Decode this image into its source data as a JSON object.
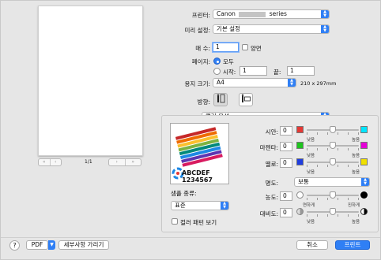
{
  "window": {
    "printer_label": "프린터:",
    "printer_value_prefix": "Canon",
    "printer_value_suffix": "series",
    "preset_label": "미리 설정:",
    "preset_value": "기본 설정",
    "copies_label": "매 수:",
    "copies_value": "1",
    "duplex_label": "양면",
    "pages_label": "페이지:",
    "pages_all": "모두",
    "pages_from": "시작:",
    "pages_from_value": "1",
    "pages_to": "끝:",
    "pages_to_value": "1",
    "paper_label": "용지 크기:",
    "paper_value": "A4",
    "paper_dims": "210 x 297mm",
    "orientation_label": "방향:",
    "section_value": "컬러 옵션"
  },
  "preview": {
    "page_indicator": "1/1",
    "first": "«",
    "prev": "‹",
    "next": "›",
    "last": "»"
  },
  "sample": {
    "text_line1": "ABCDEF",
    "text_line2": "1234567",
    "type_label": "샘플 종류:",
    "type_value": "표준",
    "pattern_label": "컬러 패턴 보기"
  },
  "color_adjust": {
    "cyan": {
      "label": "시안:",
      "value": "0",
      "low": "낮음",
      "high": "높음",
      "color": "#00c0e0",
      "swatch_left": "#e53935",
      "swatch_right": "#00e5ff"
    },
    "magenta": {
      "label": "마젠타:",
      "value": "0",
      "low": "낮음",
      "high": "높음",
      "color": "#e0007a",
      "swatch_left": "#1ec41e",
      "swatch_right": "#e600d8"
    },
    "yellow": {
      "label": "옐로:",
      "value": "0",
      "low": "낮음",
      "high": "높음",
      "color": "#f5e000",
      "swatch_left": "#1f3de0",
      "swatch_right": "#f0e000"
    },
    "tone_label": "명도:",
    "tone_value": "보통",
    "intensity": {
      "label": "농도:",
      "value": "0",
      "low": "연하게",
      "high": "진하게"
    },
    "contrast": {
      "label": "대비도:",
      "value": "0",
      "low": "낮음",
      "high": "높음"
    }
  },
  "footer": {
    "help": "?",
    "pdf": "PDF",
    "details": "세부사항 가리기",
    "cancel": "취소",
    "print": "프린트"
  }
}
